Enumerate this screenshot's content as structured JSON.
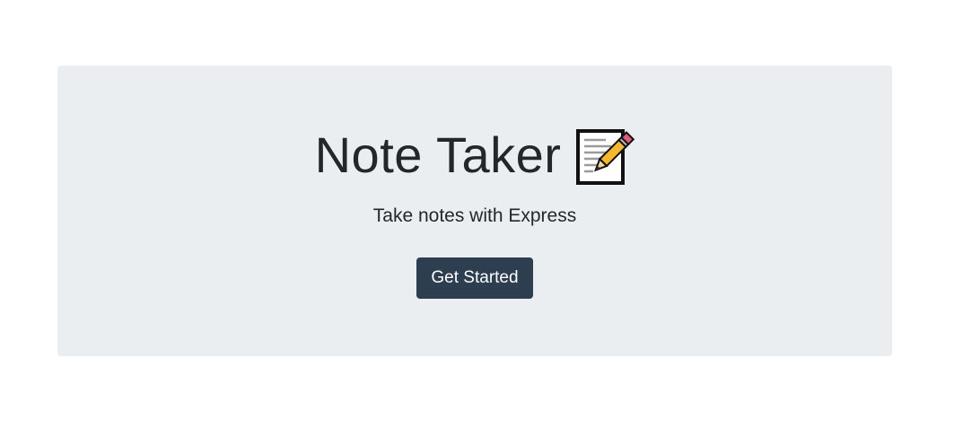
{
  "hero": {
    "title": "Note Taker",
    "title_icon": "memo-icon",
    "subtitle": "Take notes with Express",
    "cta_label": "Get Started"
  },
  "colors": {
    "page_background": "#ffffff",
    "hero_background": "#eaeef0",
    "text": "#23272b",
    "button_background": "#2c3e50",
    "button_text": "#ffffff"
  }
}
